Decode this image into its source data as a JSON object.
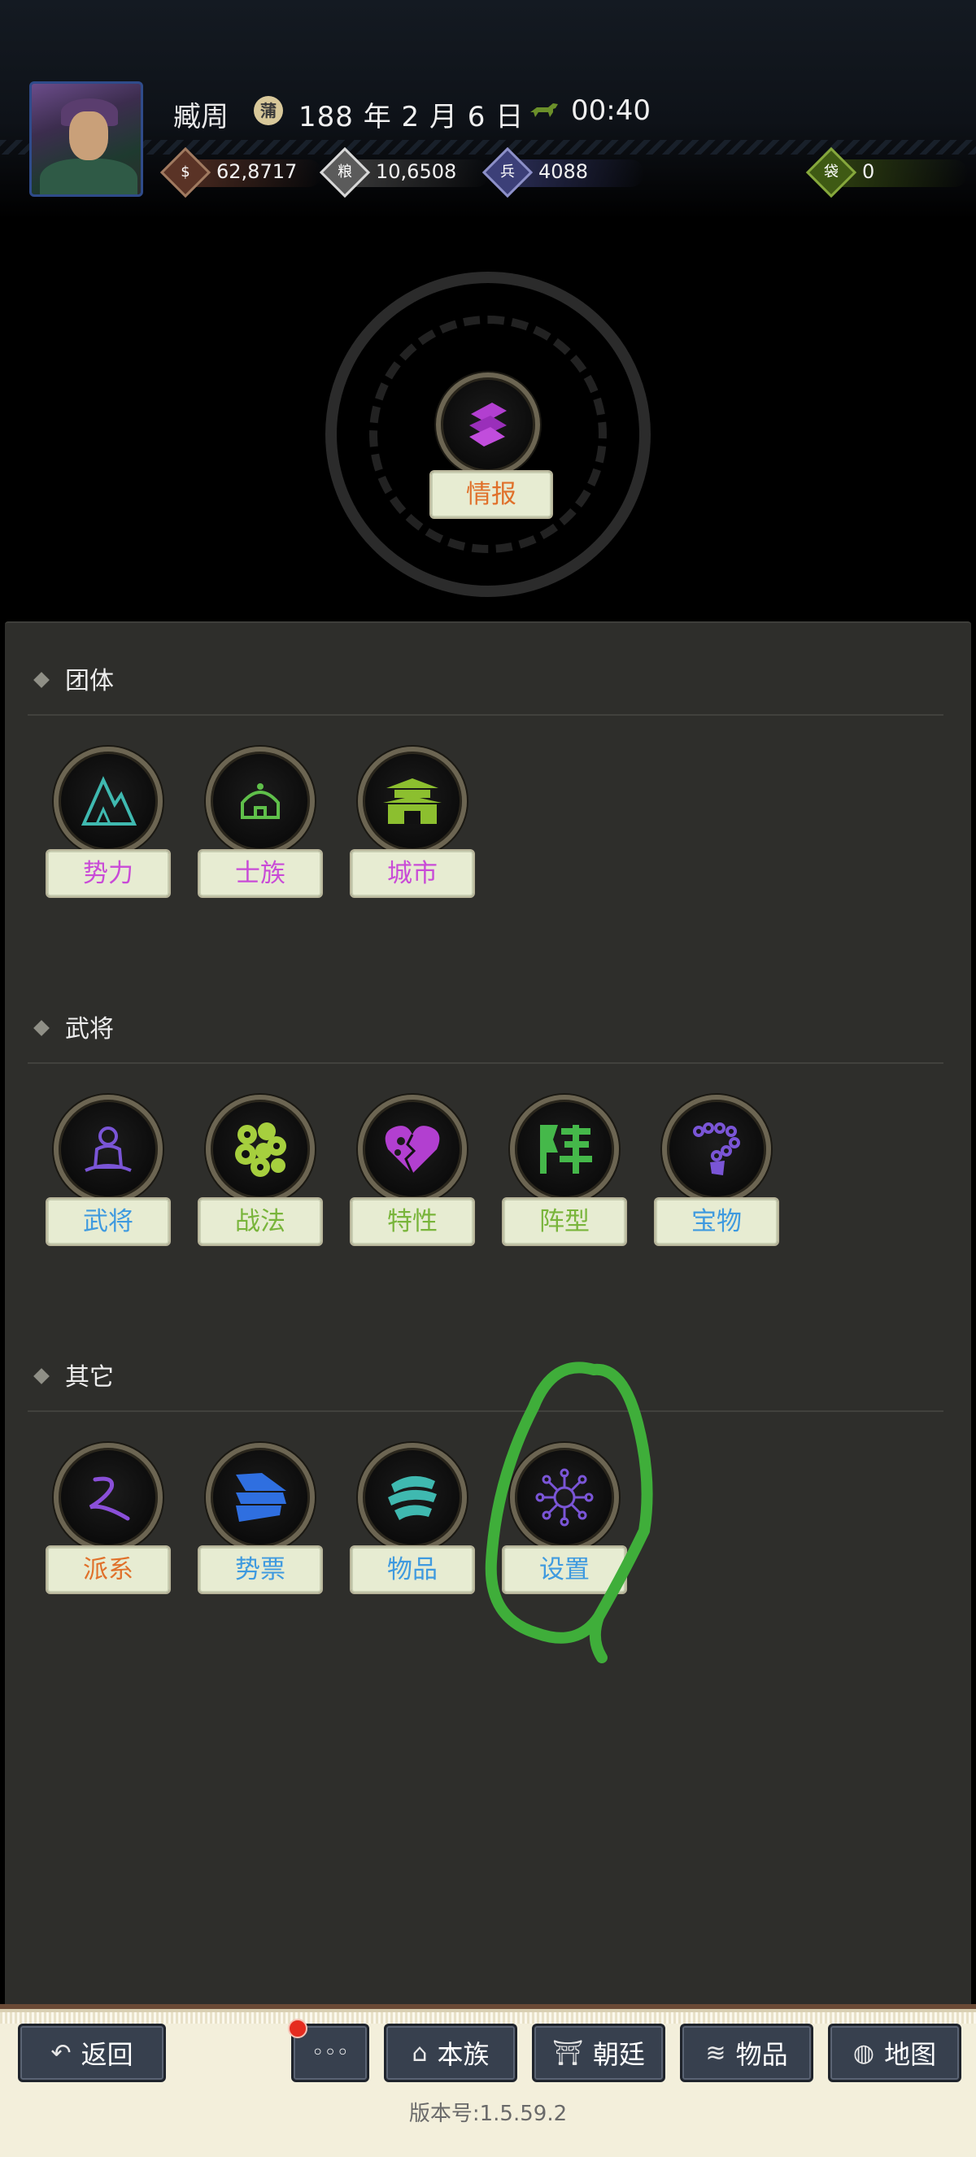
{
  "header": {
    "player_name": "臧周",
    "date_icon": "蒲",
    "date": "188 年 2 月 6 日",
    "time": "00:40",
    "resources": [
      {
        "icon": "money-icon",
        "glyph": "$",
        "value": "62,8717",
        "color": "#5a3326"
      },
      {
        "icon": "food-icon",
        "glyph": "粮",
        "value": "10,6508",
        "color": "#5b5b5b"
      },
      {
        "icon": "troops-icon",
        "glyph": "兵",
        "value": "4088",
        "color": "#3c3f78"
      },
      {
        "icon": "bag-icon",
        "glyph": "袋",
        "value": "0",
        "color": "#3f5a14"
      }
    ]
  },
  "intel": {
    "label": "情报",
    "color": "#e0702a"
  },
  "sections": [
    {
      "title": "团体",
      "items": [
        {
          "label": "势力",
          "color": "#c94bd7",
          "icon": "mountain-icon"
        },
        {
          "label": "士族",
          "color": "#c94bd7",
          "icon": "tent-icon"
        },
        {
          "label": "城市",
          "color": "#c94bd7",
          "icon": "city-gate-icon"
        }
      ]
    },
    {
      "title": "武将",
      "items": [
        {
          "label": "武将",
          "color": "#3f9adf",
          "icon": "meditating-general-icon"
        },
        {
          "label": "战法",
          "color": "#79b53b",
          "icon": "skill-cloud-icon"
        },
        {
          "label": "特性",
          "color": "#79b53b",
          "icon": "heart-icon"
        },
        {
          "label": "阵型",
          "color": "#79b53b",
          "icon": "formation-icon"
        },
        {
          "label": "宝物",
          "color": "#3f9adf",
          "icon": "treasure-icon"
        }
      ]
    },
    {
      "title": "其它",
      "items": [
        {
          "label": "派系",
          "color": "#e0702a",
          "icon": "faction-icon"
        },
        {
          "label": "势票",
          "color": "#3f9adf",
          "icon": "ticket-icon"
        },
        {
          "label": "物品",
          "color": "#3f9adf",
          "icon": "items-icon"
        },
        {
          "label": "设置",
          "color": "#3f9adf",
          "icon": "settings-icon"
        }
      ]
    }
  ],
  "nav": {
    "back": "返回",
    "more": "◦◦◦",
    "clan": "本族",
    "court": "朝廷",
    "items": "物品",
    "map": "地图"
  },
  "version": "版本号:1.5.59.2"
}
